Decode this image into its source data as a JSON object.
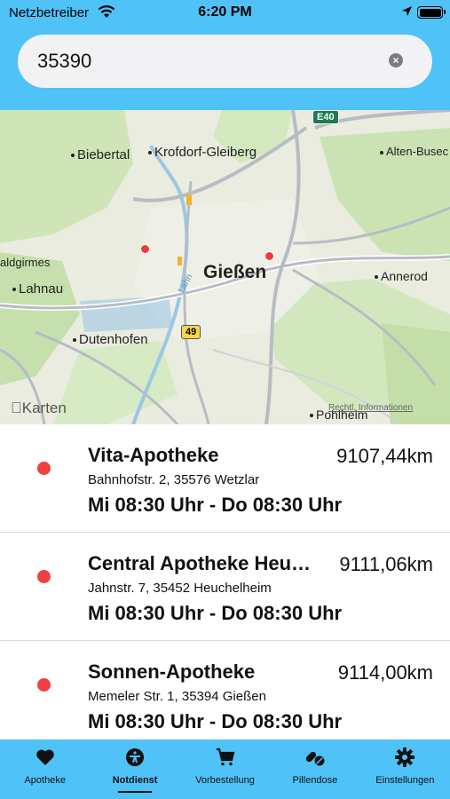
{
  "status_bar": {
    "carrier": "Netzbetreiber",
    "time": "6:20 PM"
  },
  "search": {
    "value": "35390",
    "placeholder": "",
    "clear_icon": "clear-icon"
  },
  "map": {
    "city": "Gießen",
    "places": {
      "biebertal": "Biebertal",
      "krofdorf": "Krofdorf-Gleiberg",
      "alten_buseck": "Alten-Busec",
      "aldgirmes": "aldgirmes",
      "lahnau": "Lahnau",
      "annerod": "Annerod",
      "dutenhofen": "Dutenhofen",
      "pohlheim": "Pohlheim"
    },
    "river": "Lahn",
    "road_b49": "49",
    "road_e40": "E40",
    "brand": "Karten",
    "legal": "Rechtl. Informationen"
  },
  "pharmacies": [
    {
      "name": "Vita-Apotheke",
      "distance": "9107,44km",
      "address": "Bahnhofstr. 2, 35576 Wetzlar",
      "hours": "Mi 08:30 Uhr - Do 08:30 Uhr",
      "status_color": "#ee4040"
    },
    {
      "name": "Central Apotheke Heuchelheim",
      "distance": "9111,06km",
      "address": "Jahnstr. 7, 35452 Heuchelheim",
      "hours": "Mi 08:30 Uhr - Do 08:30 Uhr",
      "status_color": "#ee4040"
    },
    {
      "name": "Sonnen-Apotheke",
      "distance": "9114,00km",
      "address": "Memeler Str. 1, 35394 Gießen",
      "hours": "Mi 08:30 Uhr - Do 08:30 Uhr",
      "status_color": "#ee4040"
    }
  ],
  "tabs": [
    {
      "label": "Apotheke",
      "icon": "heart-icon"
    },
    {
      "label": "Notdienst",
      "icon": "emergency-icon",
      "active": true
    },
    {
      "label": "Vorbestellung",
      "icon": "cart-icon"
    },
    {
      "label": "Pillendose",
      "icon": "pills-icon"
    },
    {
      "label": "Einstellungen",
      "icon": "gear-icon"
    }
  ],
  "colors": {
    "accent": "#4fc2f7",
    "pin": "#ee3a3a",
    "text": "#111111"
  }
}
